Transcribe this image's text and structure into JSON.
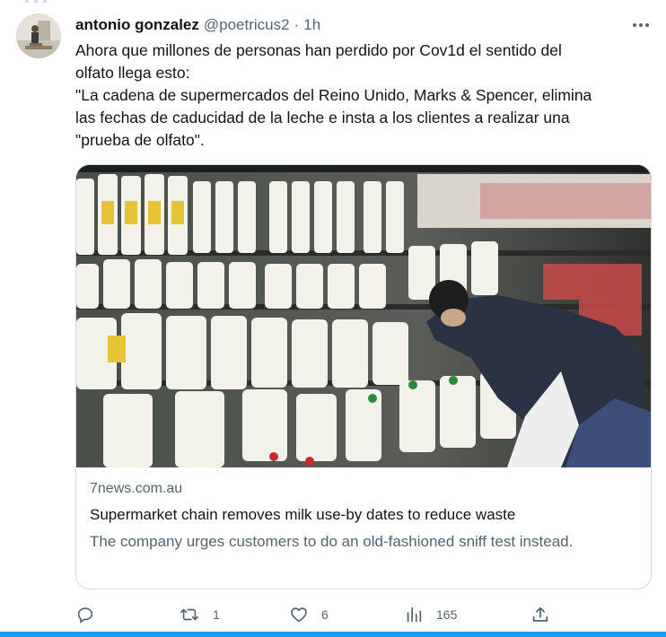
{
  "tweet": {
    "author_name": "antonio gonzalez",
    "author_handle": "@poetricus2",
    "separator": "·",
    "time": "1h",
    "text_lines": [
      "Ahora que millones de personas han perdido por Cov1d el sentido del",
      "olfato llega esto:",
      "\"La cadena de supermercados del Reino Unido, Marks & Spencer, elimina",
      "las fechas de caducidad de la leche e insta a los clientes a realizar una",
      "\"prueba de olfato\"."
    ]
  },
  "card": {
    "domain": "7news.com.au",
    "title": "Supermarket chain removes milk use-by dates to reduce waste",
    "description": "The company urges customers to do an old-fashioned sniff test instead."
  },
  "actions": {
    "reply_icon": "reply-icon",
    "retweet_icon": "retweet-icon",
    "retweets": "1",
    "like_icon": "heart-icon",
    "likes": "6",
    "views_icon": "views-chart-icon",
    "views": "165",
    "share_icon": "share-icon"
  },
  "colors": {
    "text": "#0f1419",
    "secondary": "#536471",
    "border": "#cfd9de",
    "accent": "#1d9bf0"
  }
}
